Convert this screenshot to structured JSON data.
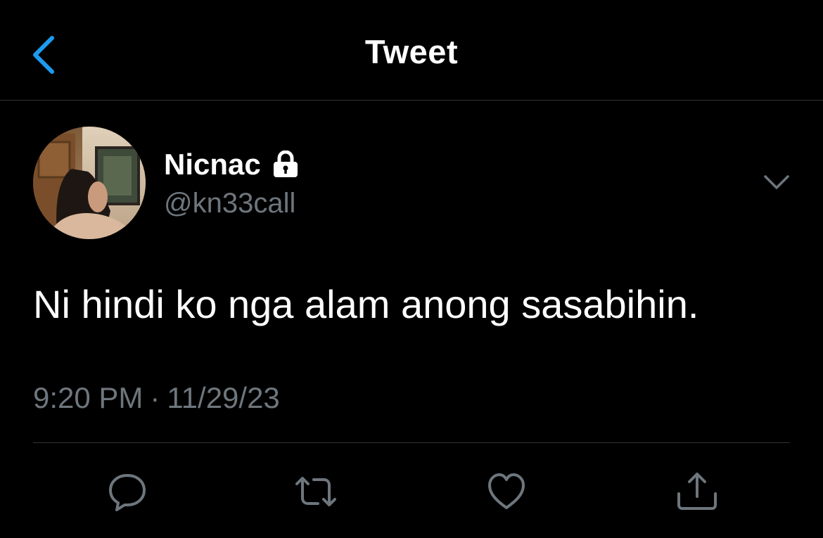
{
  "header": {
    "title": "Tweet",
    "back_icon": "chevron-left-icon"
  },
  "tweet": {
    "author": {
      "display_name": "Nicnac",
      "handle": "@kn33call",
      "protected_icon": "lock-icon"
    },
    "text": "Ni hindi ko nga alam anong sasabihin.",
    "time": "9:20 PM",
    "separator": "·",
    "date": "11/29/23",
    "menu_icon": "chevron-down-icon"
  },
  "actions": [
    {
      "name": "reply",
      "icon": "speech-bubble-icon"
    },
    {
      "name": "retweet",
      "icon": "retweet-icon"
    },
    {
      "name": "like",
      "icon": "heart-icon"
    },
    {
      "name": "share",
      "icon": "share-icon"
    }
  ],
  "colors": {
    "background": "#000000",
    "accent": "#1d9bf0",
    "text_primary": "#ffffff",
    "text_secondary": "#6e767d",
    "divider": "#2f3336"
  }
}
